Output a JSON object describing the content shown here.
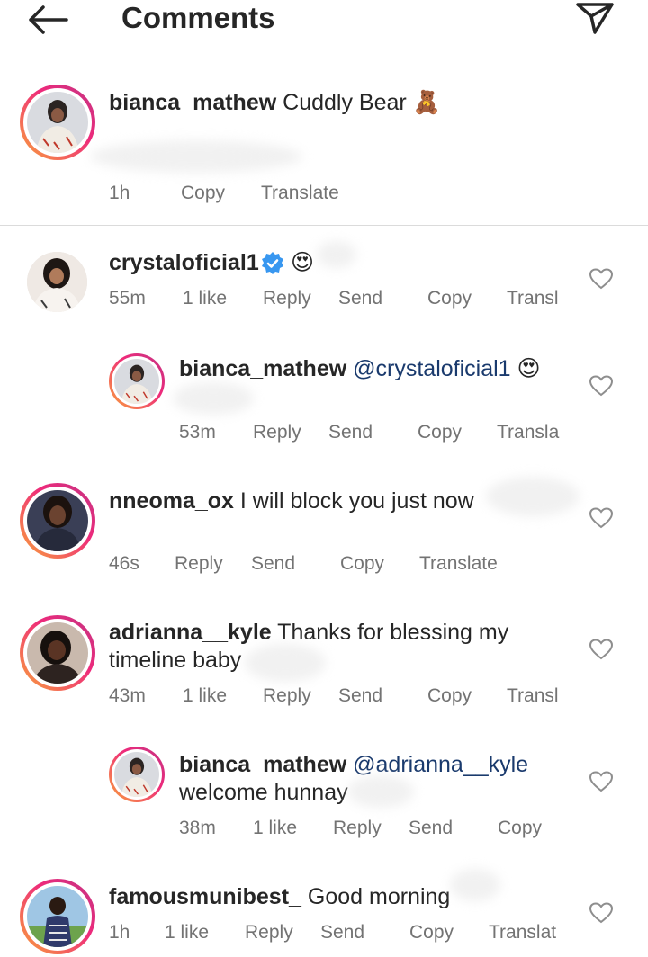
{
  "header": {
    "title": "Comments",
    "back_icon": "arrow-left-icon",
    "dm_icon": "paper-plane-icon"
  },
  "colors": {
    "text": "#262626",
    "meta": "#737373",
    "mention": "#1a3a6d",
    "verified": "#3897f0",
    "ring_start": "#f9a33b",
    "ring_end": "#c13584"
  },
  "caption": {
    "username": "bianca_mathew",
    "text": "Cuddly Bear",
    "emoji": "🧸",
    "time": "1h",
    "copy": "Copy",
    "translate": "Translate"
  },
  "comments": [
    {
      "username": "crystaloficial1",
      "emoji": "😍",
      "verified": true,
      "time": "55m",
      "likes": "1 like",
      "reply": "Reply",
      "send": "Send",
      "copy": "Copy",
      "translate": "Transl"
    },
    {
      "username": "bianca_mathew",
      "mention": "@crystaloficial1",
      "emoji": "😍",
      "time": "53m",
      "reply": "Reply",
      "send": "Send",
      "copy": "Copy",
      "translate": "Transla"
    },
    {
      "username": "nneoma_ox",
      "text": "I will block you just now",
      "time": "46s",
      "reply": "Reply",
      "send": "Send",
      "copy": "Copy",
      "translate": "Translate"
    },
    {
      "username": "adrianna__kyle",
      "text_line1": "Thanks for blessing my",
      "text_line2": "timeline baby",
      "time": "43m",
      "likes": "1 like",
      "reply": "Reply",
      "send": "Send",
      "copy": "Copy",
      "translate": "Transl"
    },
    {
      "username": "bianca_mathew",
      "mention": "@adrianna__kyle",
      "text_line2": "welcome hunnay",
      "time": "38m",
      "likes": "1 like",
      "reply": "Reply",
      "send": "Send",
      "copy": "Copy"
    },
    {
      "username": "famousmunibest_",
      "text": "Good morning",
      "time": "1h",
      "likes": "1 like",
      "reply": "Reply",
      "send": "Send",
      "copy": "Copy",
      "translate": "Translat"
    }
  ]
}
